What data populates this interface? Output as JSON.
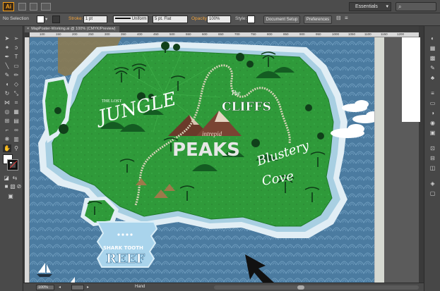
{
  "app": {
    "logo": "Ai",
    "workspace": "Essentials",
    "search_icon": "search-icon"
  },
  "control_bar": {
    "selection": "No Selection",
    "stroke_label": "Stroke:",
    "stroke_weight": "1 pt",
    "profile": "Uniform",
    "brush": "5 pt. Flat",
    "opacity_label": "Opacity:",
    "opacity_value": "100%",
    "style_label": "Style:",
    "document_setup": "Document Setup",
    "preferences": "Preferences"
  },
  "document": {
    "tab_title": "MapPoster-Working.ai @ 100% (CMYK/Preview)"
  },
  "ruler": {
    "ticks": [
      "100",
      "150",
      "200",
      "250",
      "300",
      "350",
      "400",
      "450",
      "500",
      "550",
      "600",
      "650",
      "700",
      "750",
      "800",
      "850",
      "900",
      "950",
      "1000",
      "1050",
      "1100",
      "1150",
      "1200"
    ]
  },
  "map": {
    "the_lost": "THE LOST",
    "jungle": "JUNGLE",
    "the": "The",
    "cliffs": "CLIFFS",
    "intrepid": "intrepid",
    "peaks": "PEAKS",
    "blustery": "Blustery",
    "cove": "Cove",
    "shark_tooth": "SHARK TOOTH",
    "reef": "REEF",
    "colors": {
      "ocean": "#4b7ba0",
      "land": "#2f9a3a",
      "shore": "#cfe6f0",
      "reef_box": "#a9d4ec"
    }
  },
  "status_bar": {
    "zoom": "100%",
    "tool": "Hand"
  }
}
